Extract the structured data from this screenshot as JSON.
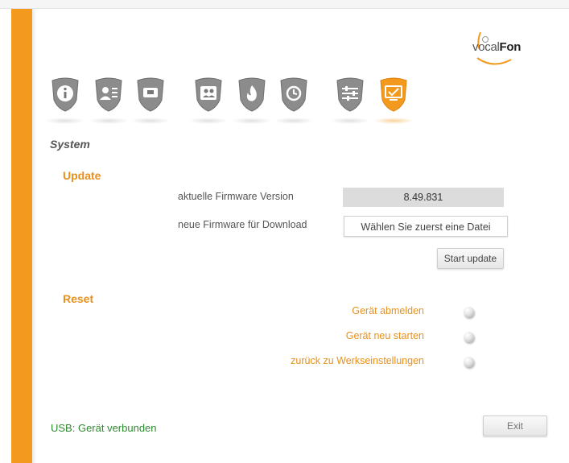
{
  "brand": {
    "logo_prefix": "vocal",
    "logo_suffix": "Fon"
  },
  "nav": {
    "items": [
      {
        "name": "info-icon"
      },
      {
        "name": "user-list-icon"
      },
      {
        "name": "phone-icon"
      },
      {
        "name": "contacts-icon"
      },
      {
        "name": "fire-icon"
      },
      {
        "name": "alarm-clock-icon"
      },
      {
        "name": "settings-sliders-icon"
      },
      {
        "name": "system-monitor-icon",
        "active": true
      }
    ],
    "accent_color": "#f39a1e"
  },
  "page": {
    "title": "System"
  },
  "update": {
    "heading": "Update",
    "firmware_label": "aktuelle Firmware Version",
    "firmware_value": "8.49.831",
    "download_label": "neue Firmware für Download",
    "file_placeholder": "Wählen Sie zuerst eine Datei",
    "start_button": "Start update"
  },
  "reset": {
    "heading": "Reset",
    "options": [
      {
        "label": "Gerät abmelden"
      },
      {
        "label": "Gerät neu starten"
      },
      {
        "label": "zurück zu Werkseinstellungen"
      }
    ]
  },
  "footer": {
    "usb_status": "USB: Gerät verbunden",
    "exit_button": "Exit"
  }
}
